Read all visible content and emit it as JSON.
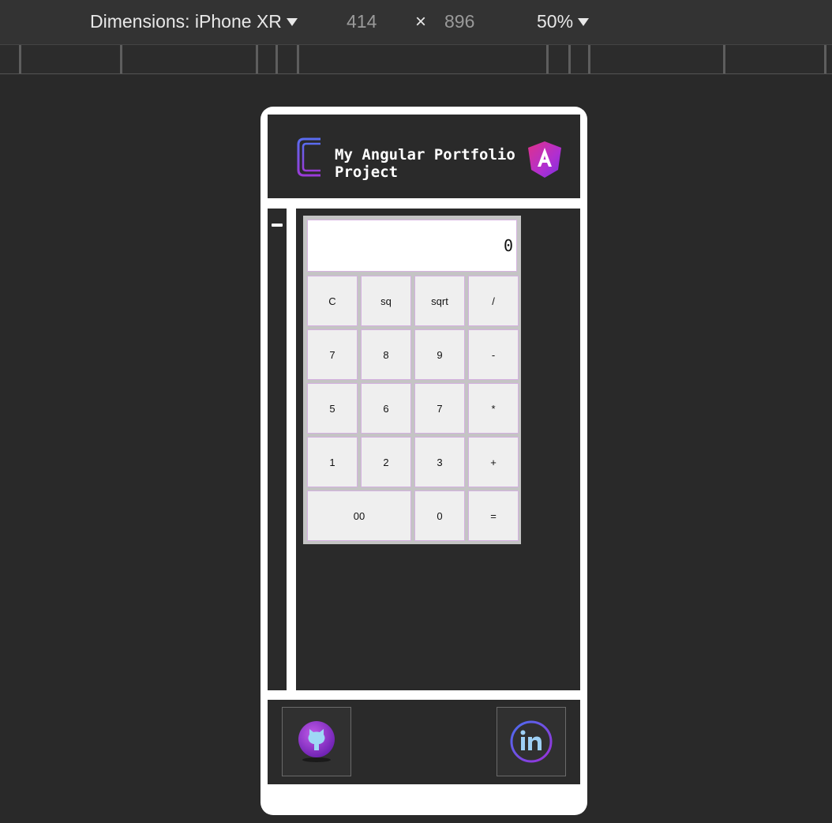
{
  "devtools": {
    "dimensions_label": "Dimensions: iPhone XR",
    "width": "414",
    "times": "×",
    "height": "896",
    "zoom": "50%"
  },
  "header": {
    "title_line1": "My Angular Portfolio",
    "title_line2": "Project"
  },
  "calculator": {
    "display": "0",
    "keys": [
      {
        "label": "C"
      },
      {
        "label": "sq"
      },
      {
        "label": "sqrt"
      },
      {
        "label": "/"
      },
      {
        "label": "7"
      },
      {
        "label": "8"
      },
      {
        "label": "9"
      },
      {
        "label": "-"
      },
      {
        "label": "5"
      },
      {
        "label": "6"
      },
      {
        "label": "7"
      },
      {
        "label": "*"
      },
      {
        "label": "1"
      },
      {
        "label": "2"
      },
      {
        "label": "3"
      },
      {
        "label": "+"
      },
      {
        "label": "00"
      },
      {
        "label": "0"
      },
      {
        "label": "="
      }
    ]
  },
  "footer": {
    "links": [
      {
        "icon": "github-icon"
      },
      {
        "icon": "linkedin-icon"
      }
    ]
  },
  "colors": {
    "page_bg": "#292929",
    "panel_bg": "#2a2a2a",
    "key_bg": "#efefef",
    "key_border": "#d4b0e0",
    "accent_purple": "#8e3bd9",
    "accent_pink": "#e0318a"
  }
}
